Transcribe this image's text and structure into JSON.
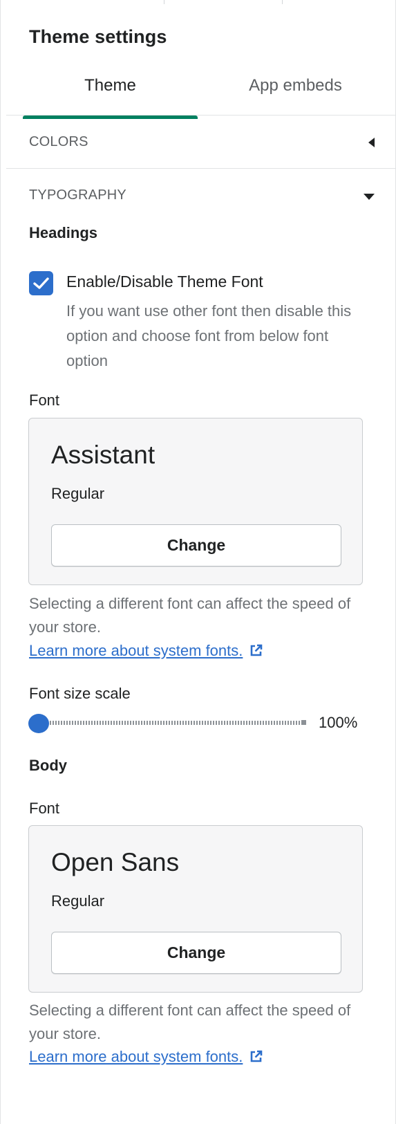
{
  "panel": {
    "title": "Theme settings"
  },
  "tabs": [
    {
      "label": "Theme",
      "active": true
    },
    {
      "label": "App embeds",
      "active": false
    }
  ],
  "sections": {
    "colors": {
      "label": "COLORS",
      "expanded": false
    },
    "typography": {
      "label": "TYPOGRAPHY",
      "expanded": true
    }
  },
  "headings": {
    "title": "Headings",
    "theme_font_toggle": {
      "label": "Enable/Disable Theme Font",
      "checked": true,
      "help": "If you want use other font then disable this option and choose font from below font option"
    },
    "font_label": "Font",
    "font": {
      "name": "Assistant",
      "style": "Regular",
      "button": "Change"
    },
    "help": "Selecting a different font can affect the speed of your store.",
    "link": "Learn more about system fonts.",
    "scale": {
      "label": "Font size scale",
      "value_text": "100%",
      "fraction": 0.0
    }
  },
  "body": {
    "title": "Body",
    "font_label": "Font",
    "font": {
      "name": "Open Sans",
      "style": "Regular",
      "button": "Change"
    },
    "help": "Selecting a different font can affect the speed of your store.",
    "link": "Learn more about system fonts."
  },
  "colors": {
    "accent": "#008060",
    "primary_blue": "#2c6ecb",
    "text": "#202223",
    "subdued_text": "#6d7175",
    "card_bg": "#f6f6f7"
  },
  "icons": {
    "checkbox": "checkmark-icon",
    "external_link": "external-link-icon",
    "collapsed": "caret-left-icon",
    "expanded": "caret-down-icon"
  }
}
